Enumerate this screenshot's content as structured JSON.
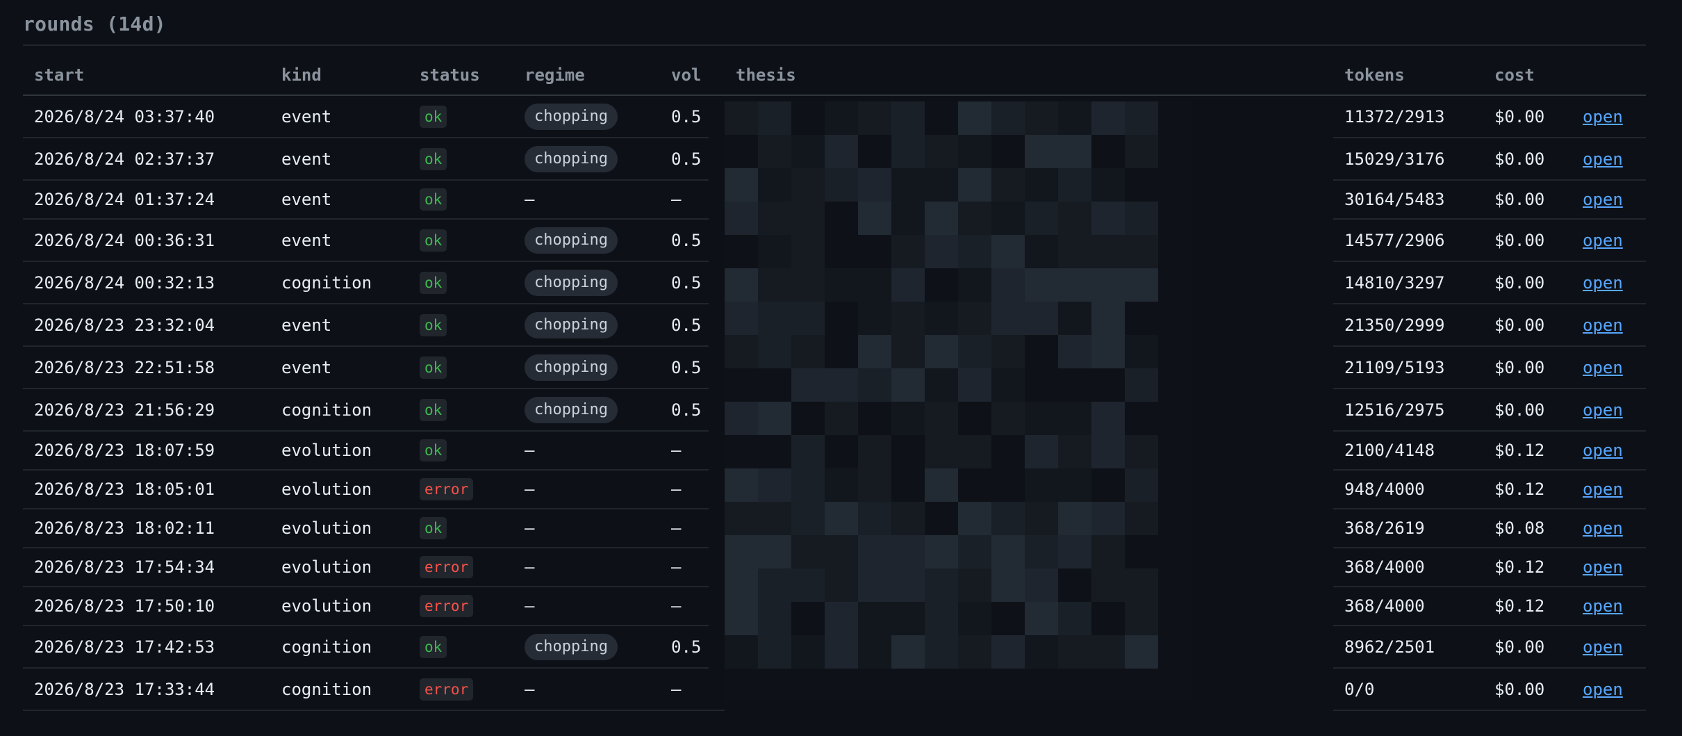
{
  "section": {
    "title": "rounds (14d)"
  },
  "columns": {
    "start": "start",
    "kind": "kind",
    "status": "status",
    "regime": "regime",
    "vol": "vol",
    "thesis": "thesis",
    "tokens": "tokens",
    "cost": "cost"
  },
  "rows": [
    {
      "start": "2026/8/24 03:37:40",
      "kind": "event",
      "status": "ok",
      "regime": "chopping",
      "vol": "0.5",
      "tokens": "11372/2913",
      "cost": "$0.00",
      "link": "open"
    },
    {
      "start": "2026/8/24 02:37:37",
      "kind": "event",
      "status": "ok",
      "regime": "chopping",
      "vol": "0.5",
      "tokens": "15029/3176",
      "cost": "$0.00",
      "link": "open"
    },
    {
      "start": "2026/8/24 01:37:24",
      "kind": "event",
      "status": "ok",
      "regime": "—",
      "vol": "—",
      "tokens": "30164/5483",
      "cost": "$0.00",
      "link": "open"
    },
    {
      "start": "2026/8/24 00:36:31",
      "kind": "event",
      "status": "ok",
      "regime": "chopping",
      "vol": "0.5",
      "tokens": "14577/2906",
      "cost": "$0.00",
      "link": "open"
    },
    {
      "start": "2026/8/24 00:32:13",
      "kind": "cognition",
      "status": "ok",
      "regime": "chopping",
      "vol": "0.5",
      "tokens": "14810/3297",
      "cost": "$0.00",
      "link": "open"
    },
    {
      "start": "2026/8/23 23:32:04",
      "kind": "event",
      "status": "ok",
      "regime": "chopping",
      "vol": "0.5",
      "tokens": "21350/2999",
      "cost": "$0.00",
      "link": "open"
    },
    {
      "start": "2026/8/23 22:51:58",
      "kind": "event",
      "status": "ok",
      "regime": "chopping",
      "vol": "0.5",
      "tokens": "21109/5193",
      "cost": "$0.00",
      "link": "open"
    },
    {
      "start": "2026/8/23 21:56:29",
      "kind": "cognition",
      "status": "ok",
      "regime": "chopping",
      "vol": "0.5",
      "tokens": "12516/2975",
      "cost": "$0.00",
      "link": "open"
    },
    {
      "start": "2026/8/23 18:07:59",
      "kind": "evolution",
      "status": "ok",
      "regime": "—",
      "vol": "—",
      "tokens": "2100/4148",
      "cost": "$0.12",
      "link": "open"
    },
    {
      "start": "2026/8/23 18:05:01",
      "kind": "evolution",
      "status": "error",
      "regime": "—",
      "vol": "—",
      "tokens": "948/4000",
      "cost": "$0.12",
      "link": "open"
    },
    {
      "start": "2026/8/23 18:02:11",
      "kind": "evolution",
      "status": "ok",
      "regime": "—",
      "vol": "—",
      "tokens": "368/2619",
      "cost": "$0.08",
      "link": "open"
    },
    {
      "start": "2026/8/23 17:54:34",
      "kind": "evolution",
      "status": "error",
      "regime": "—",
      "vol": "—",
      "tokens": "368/4000",
      "cost": "$0.12",
      "link": "open"
    },
    {
      "start": "2026/8/23 17:50:10",
      "kind": "evolution",
      "status": "error",
      "regime": "—",
      "vol": "—",
      "tokens": "368/4000",
      "cost": "$0.12",
      "link": "open"
    },
    {
      "start": "2026/8/23 17:42:53",
      "kind": "cognition",
      "status": "ok",
      "regime": "chopping",
      "vol": "0.5",
      "tokens": "8962/2501",
      "cost": "$0.00",
      "link": "open"
    },
    {
      "start": "2026/8/23 17:33:44",
      "kind": "cognition",
      "status": "error",
      "regime": "—",
      "vol": "—",
      "tokens": "0/0",
      "cost": "$0.00",
      "link": "open"
    }
  ],
  "colors": {
    "background": "#0d1117",
    "ok": "#3fb950",
    "error": "#f85149",
    "link": "#58a6ff",
    "muted": "#8b949e"
  }
}
